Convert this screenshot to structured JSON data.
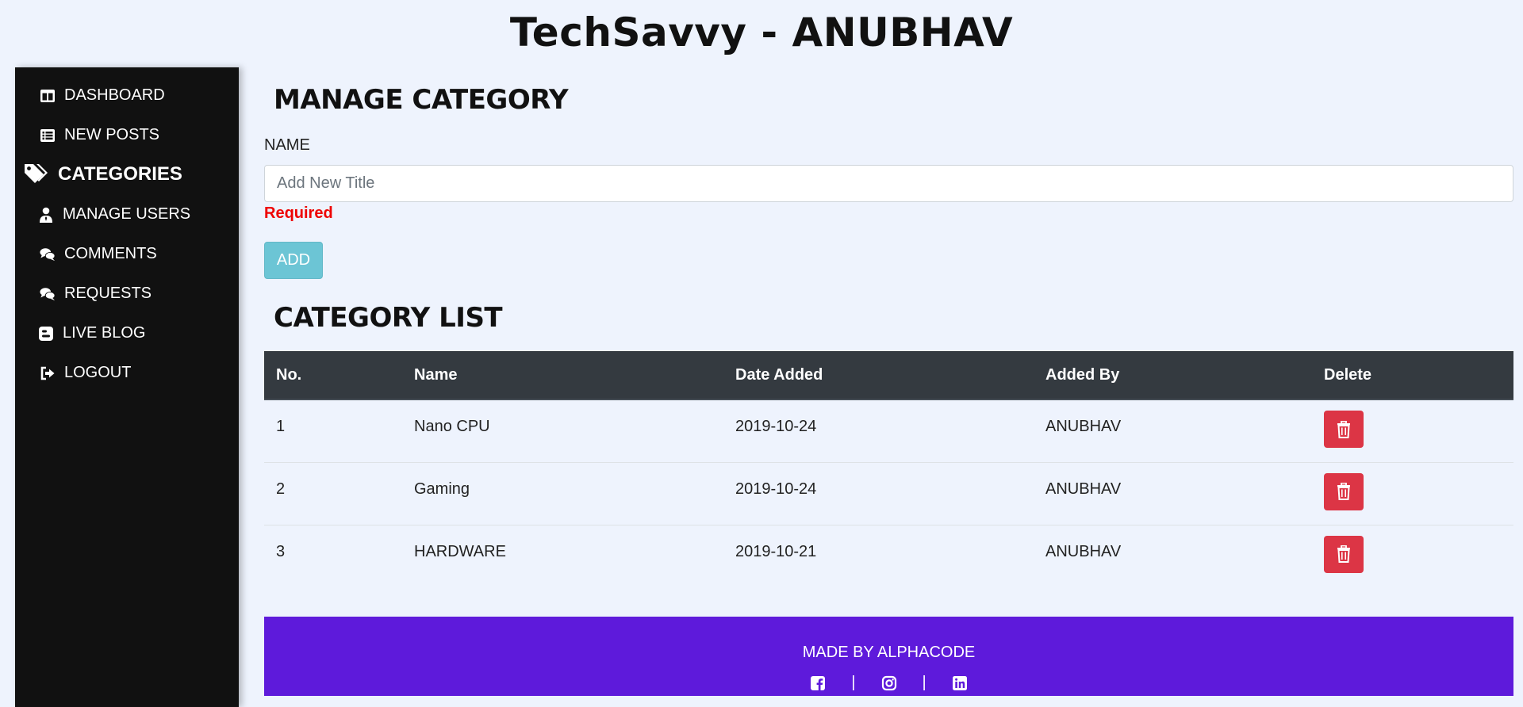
{
  "site_title": "TechSavvy - ANUBHAV",
  "sidebar": {
    "items": [
      {
        "label": "DASHBOARD",
        "icon": "columns-icon"
      },
      {
        "label": "NEW POSTS",
        "icon": "list-icon"
      },
      {
        "label": "CATEGORIES",
        "icon": "tags-icon",
        "active": true
      },
      {
        "label": "MANAGE USERS",
        "icon": "user-tie-icon"
      },
      {
        "label": "COMMENTS",
        "icon": "comments-icon"
      },
      {
        "label": "REQUESTS",
        "icon": "comments-icon"
      },
      {
        "label": "LIVE BLOG",
        "icon": "blogger-icon"
      },
      {
        "label": "LOGOUT",
        "icon": "sign-out-icon"
      }
    ]
  },
  "manage": {
    "heading": "MANAGE CATEGORY",
    "name_label": "NAME",
    "input_placeholder": "Add New Title",
    "input_value": "",
    "required_text": "Required",
    "add_label": "ADD"
  },
  "list": {
    "heading": "CATEGORY LIST",
    "columns": [
      "No.",
      "Name",
      "Date Added",
      "Added By",
      "Delete"
    ],
    "rows": [
      {
        "no": "1",
        "name": "Nano CPU",
        "date": "2019-10-24",
        "added_by": "ANUBHAV"
      },
      {
        "no": "2",
        "name": "Gaming",
        "date": "2019-10-24",
        "added_by": "ANUBHAV"
      },
      {
        "no": "3",
        "name": "HARDWARE",
        "date": "2019-10-21",
        "added_by": "ANUBHAV"
      }
    ]
  },
  "footer": {
    "made_by": "MADE BY ALPHACODE",
    "separator": "|",
    "socials": [
      "facebook-icon",
      "instagram-icon",
      "linkedin-icon"
    ]
  },
  "colors": {
    "page_bg": "#eef3fd",
    "sidebar_bg": "#111111",
    "table_header_bg": "#343a40",
    "delete_red": "#dc3545",
    "add_button": "#6cc5d5",
    "footer_purple": "#5e1adb",
    "required_red": "#ee0000"
  }
}
